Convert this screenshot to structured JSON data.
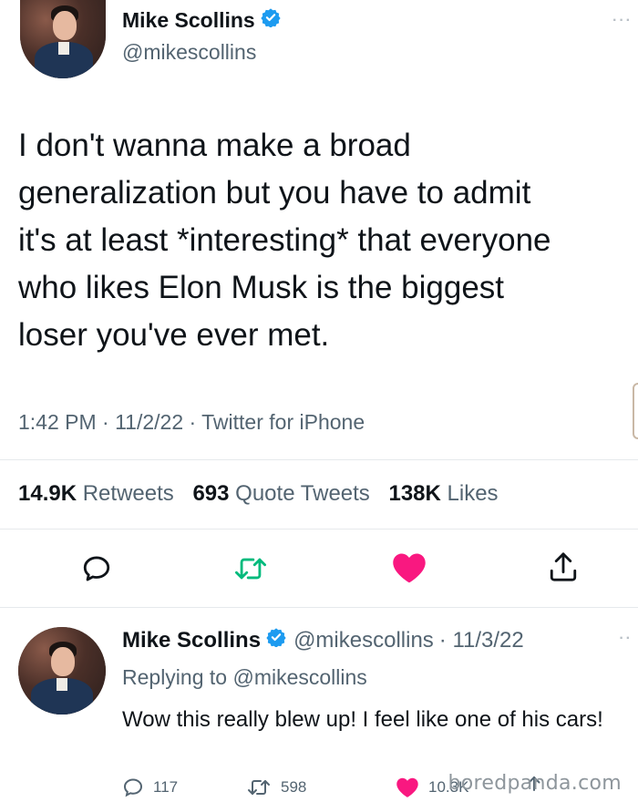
{
  "tweet": {
    "author_name": "Mike Scollins",
    "author_handle": "@mikescollins",
    "more_label": "···",
    "body_lines": [
      "I don't wanna make a broad",
      "generalization but you have to admit",
      "it's at least *interesting* that everyone",
      "who likes Elon Musk is the biggest",
      "loser you've ever met."
    ],
    "meta": "1:42 PM · 11/2/22 · Twitter for iPhone",
    "stats": {
      "retweets_count": "14.9K",
      "retweets_label": "Retweets",
      "quotes_count": "693",
      "quotes_label": "Quote Tweets",
      "likes_count": "138K",
      "likes_label": "Likes"
    }
  },
  "reply": {
    "author_name": "Mike Scollins",
    "author_handle": "@mikescollins",
    "date": "· 11/3/22",
    "more_label": "··",
    "replying_prefix": "Replying to",
    "replying_handle": "@mikescollins",
    "text": "Wow this really blew up! I feel like one of his cars!",
    "reply_count": "117",
    "retweet_count": "598",
    "like_count": "10.3K"
  },
  "watermark": "boredpanda.com",
  "colors": {
    "verified": "#1d9bf0",
    "retweet_active": "#00ba7c",
    "like_active": "#f91880",
    "muted": "#536471"
  },
  "icons": [
    "verified-badge-icon",
    "reply-icon",
    "retweet-icon",
    "heart-icon",
    "share-icon"
  ]
}
